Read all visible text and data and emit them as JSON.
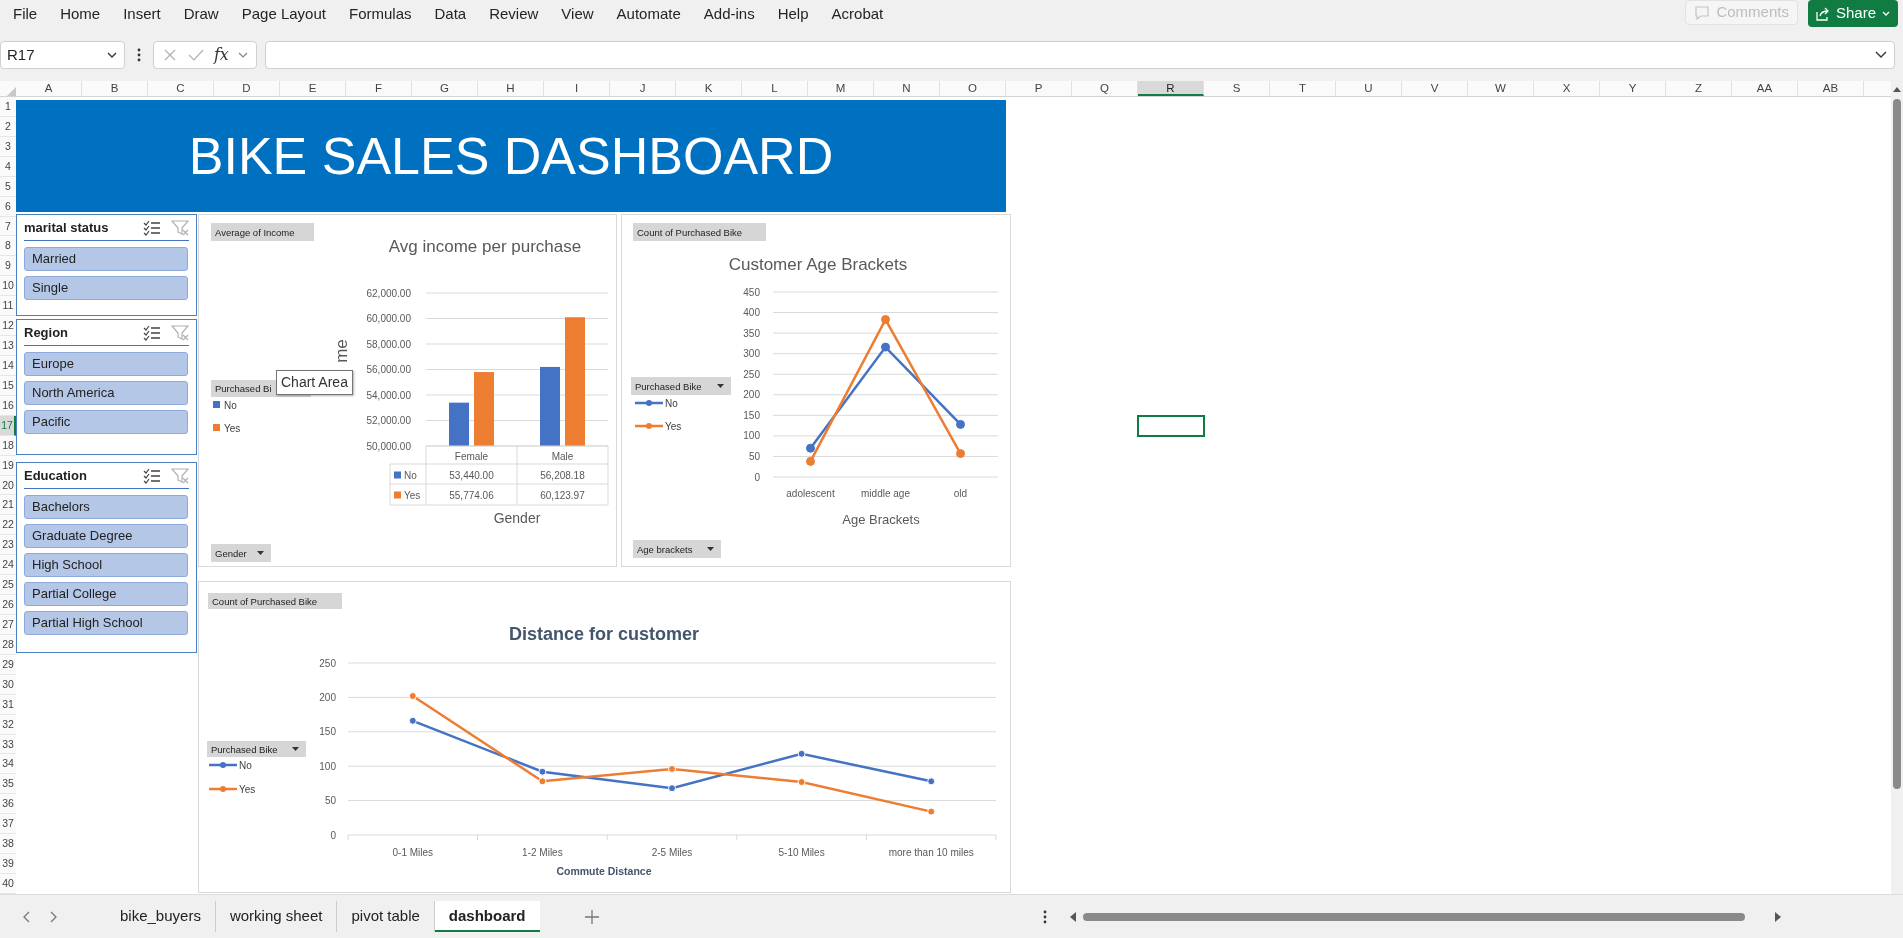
{
  "menu_bar": {
    "items": [
      "File",
      "Home",
      "Insert",
      "Draw",
      "Page Layout",
      "Formulas",
      "Data",
      "Review",
      "View",
      "Automate",
      "Add-ins",
      "Help",
      "Acrobat"
    ],
    "comments_button": {
      "label": "Comments",
      "disabled": true
    },
    "share_button": {
      "label": "Share"
    }
  },
  "formula_bar": {
    "name_box": "R17",
    "function_label": "fx"
  },
  "sheet": {
    "columns": [
      {
        "label": "A",
        "selected": false
      },
      {
        "label": "B",
        "selected": false
      },
      {
        "label": "C",
        "selected": false
      },
      {
        "label": "D",
        "selected": false
      },
      {
        "label": "E",
        "selected": false
      },
      {
        "label": "F",
        "selected": false
      },
      {
        "label": "G",
        "selected": false
      },
      {
        "label": "H",
        "selected": false
      },
      {
        "label": "I",
        "selected": false
      },
      {
        "label": "J",
        "selected": false
      },
      {
        "label": "K",
        "selected": false
      },
      {
        "label": "L",
        "selected": false
      },
      {
        "label": "M",
        "selected": false
      },
      {
        "label": "N",
        "selected": false
      },
      {
        "label": "O",
        "selected": false
      },
      {
        "label": "P",
        "selected": false
      },
      {
        "label": "Q",
        "selected": false
      },
      {
        "label": "R",
        "selected": true
      },
      {
        "label": "S",
        "selected": false
      },
      {
        "label": "T",
        "selected": false
      },
      {
        "label": "U",
        "selected": false
      },
      {
        "label": "V",
        "selected": false
      },
      {
        "label": "W",
        "selected": false
      },
      {
        "label": "X",
        "selected": false
      },
      {
        "label": "Y",
        "selected": false
      },
      {
        "label": "Z",
        "selected": false
      },
      {
        "label": "AA",
        "selected": false
      },
      {
        "label": "AB",
        "selected": false
      }
    ],
    "rows": [
      {
        "label": "1",
        "selected": false
      },
      {
        "label": "2",
        "selected": false
      },
      {
        "label": "3",
        "selected": false
      },
      {
        "label": "4",
        "selected": false
      },
      {
        "label": "5",
        "selected": false
      },
      {
        "label": "6",
        "selected": false
      },
      {
        "label": "7",
        "selected": false
      },
      {
        "label": "8",
        "selected": false
      },
      {
        "label": "9",
        "selected": false
      },
      {
        "label": "10",
        "selected": false
      },
      {
        "label": "11",
        "selected": false
      },
      {
        "label": "12",
        "selected": false
      },
      {
        "label": "13",
        "selected": false
      },
      {
        "label": "14",
        "selected": false
      },
      {
        "label": "15",
        "selected": false
      },
      {
        "label": "16",
        "selected": false
      },
      {
        "label": "17",
        "selected": true
      },
      {
        "label": "18",
        "selected": false
      },
      {
        "label": "19",
        "selected": false
      },
      {
        "label": "20",
        "selected": false
      },
      {
        "label": "21",
        "selected": false
      },
      {
        "label": "22",
        "selected": false
      },
      {
        "label": "23",
        "selected": false
      },
      {
        "label": "24",
        "selected": false
      },
      {
        "label": "25",
        "selected": false
      },
      {
        "label": "26",
        "selected": false
      },
      {
        "label": "27",
        "selected": false
      },
      {
        "label": "28",
        "selected": false
      },
      {
        "label": "29",
        "selected": false
      },
      {
        "label": "30",
        "selected": false
      },
      {
        "label": "31",
        "selected": false
      },
      {
        "label": "32",
        "selected": false
      },
      {
        "label": "33",
        "selected": false
      },
      {
        "label": "34",
        "selected": false
      },
      {
        "label": "35",
        "selected": false
      },
      {
        "label": "36",
        "selected": false
      },
      {
        "label": "37",
        "selected": false
      },
      {
        "label": "38",
        "selected": false
      },
      {
        "label": "39",
        "selected": false
      },
      {
        "label": "40",
        "selected": false
      }
    ]
  },
  "dashboard": {
    "title": "BIKE SALES DASHBOARD"
  },
  "slicers": [
    {
      "title": "marital status",
      "items": [
        {
          "label": "Married",
          "selected": true
        },
        {
          "label": "Single",
          "selected": true
        }
      ]
    },
    {
      "title": "Region",
      "items": [
        {
          "label": "Europe",
          "selected": true
        },
        {
          "label": "North America",
          "selected": true
        },
        {
          "label": "Pacific",
          "selected": true
        }
      ]
    },
    {
      "title": "Education",
      "items": [
        {
          "label": "Bachelors",
          "selected": true
        },
        {
          "label": "Graduate Degree",
          "selected": true
        },
        {
          "label": "High School",
          "selected": true
        },
        {
          "label": "Partial College",
          "selected": true
        },
        {
          "label": "Partial High School",
          "selected": true
        }
      ]
    }
  ],
  "charts": [
    {
      "field_buttons": [
        {
          "label": "Average of Income",
          "dropdown": false
        },
        {
          "label": "Purchased Bi"
        },
        {
          "label": "Gender",
          "dropdown": true
        }
      ],
      "data_table": [
        {
          "key": "No",
          "cells": [
            "53,440.00",
            "56,208.18"
          ]
        },
        {
          "key": "Yes",
          "cells": [
            "55,774.06",
            "60,123.97"
          ]
        }
      ],
      "tooltip": "Chart Area",
      "chart_data": {
        "type": "bar",
        "title": "Avg income per purchase",
        "xlabel": "Gender",
        "ylabel": "me",
        "categories": [
          "Female",
          "Male"
        ],
        "legend": "left",
        "grid": true,
        "series": [
          {
            "name": "No",
            "color": "#4472c4",
            "values": [
              53400,
              56200
            ]
          },
          {
            "name": "Yes",
            "color": "#ed7d31",
            "values": [
              55800,
              60100
            ]
          }
        ],
        "ylim": [
          50000,
          62000
        ],
        "yticks": [
          {
            "value": 50000,
            "label": "50,000.00"
          },
          {
            "value": 52000,
            "label": "52,000.00"
          },
          {
            "value": 54000,
            "label": "54,000.00"
          },
          {
            "value": 56000,
            "label": "56,000.00"
          },
          {
            "value": 58000,
            "label": "58,000.00"
          },
          {
            "value": 60000,
            "label": "60,000.00"
          },
          {
            "value": 62000,
            "label": "62,000.00"
          }
        ]
      }
    },
    {
      "field_buttons": [
        {
          "label": "Count of Purchased Bike",
          "dropdown": false
        },
        {
          "label": "Purchased Bike",
          "dropdown": true
        },
        {
          "label": "Age brackets",
          "dropdown": true
        }
      ],
      "chart_data": {
        "type": "line",
        "title": "Customer Age Brackets",
        "xlabel": "Age Brackets",
        "categories": [
          "adolescent",
          "middle age",
          "old"
        ],
        "legend": "left",
        "grid": true,
        "series": [
          {
            "name": "No",
            "color": "#4472c4",
            "marker": "circle",
            "values": [
              70,
              316,
              128
            ]
          },
          {
            "name": "Yes",
            "color": "#ed7d31",
            "marker": "circle",
            "values": [
              38,
              383,
              57
            ]
          }
        ],
        "ylim": [
          0,
          450
        ],
        "yticks": [
          0,
          50,
          100,
          150,
          200,
          250,
          300,
          350,
          400,
          450
        ]
      }
    },
    {
      "field_buttons": [
        {
          "label": "Count of Purchased Bike",
          "dropdown": false
        },
        {
          "label": "Purchased Bike",
          "dropdown": true
        }
      ],
      "chart_data": {
        "type": "line",
        "title": "Distance for customer",
        "xlabel": "Commute Distance",
        "categories": [
          "0-1 Miles",
          "1-2 Miles",
          "2-5 Miles",
          "5-10 Miles",
          "more than 10 miles"
        ],
        "legend": "left",
        "grid": true,
        "series": [
          {
            "name": "No",
            "color": "#4472c4",
            "marker": "circle",
            "values": [
              166,
              92,
              68,
              118,
              78
            ]
          },
          {
            "name": "Yes",
            "color": "#ed7d31",
            "marker": "circle",
            "values": [
              202,
              78,
              96,
              77,
              34
            ]
          }
        ],
        "ylim": [
          0,
          250
        ],
        "yticks": [
          0,
          50,
          100,
          150,
          200,
          250
        ]
      }
    }
  ],
  "sheet_tabs": [
    {
      "label": "bike_buyers",
      "selected": false
    },
    {
      "label": "working sheet",
      "selected": false
    },
    {
      "label": "pivot table",
      "selected": false
    },
    {
      "label": "dashboard",
      "selected": true
    }
  ]
}
